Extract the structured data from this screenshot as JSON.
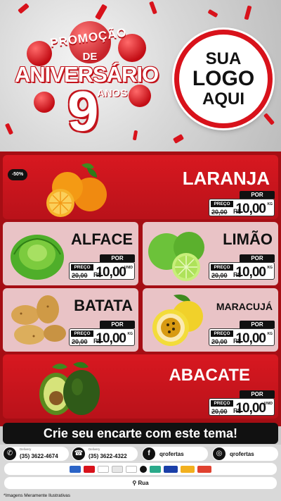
{
  "hero": {
    "promo_word": "PROMOÇÃO",
    "de": "DE",
    "aniversario": "ANIVERSÁRIO",
    "number": "9",
    "anos": "ANOS",
    "logo_line1": "SUA",
    "logo_line2": "LOGO",
    "logo_line3": "AQUI"
  },
  "offers": [
    {
      "name": "LARANJA",
      "discount": "-50%",
      "preco_label": "PREÇO",
      "por_label": "POR",
      "old_price": "20,00",
      "currency": "R$",
      "new_price": "10,00",
      "unit": "KG"
    },
    {
      "name": "ALFACE",
      "preco_label": "PREÇO",
      "por_label": "POR",
      "old_price": "20,00",
      "currency": "R$",
      "new_price": "10,00",
      "unit": "UNID"
    },
    {
      "name": "LIMÃO",
      "preco_label": "PREÇO",
      "por_label": "POR",
      "old_price": "20,00",
      "currency": "R$",
      "new_price": "10,00",
      "unit": "KG"
    },
    {
      "name": "BATATA",
      "preco_label": "PREÇO",
      "por_label": "POR",
      "old_price": "20,00",
      "currency": "R$",
      "new_price": "10,00",
      "unit": "KG"
    },
    {
      "name": "MARACUJÁ",
      "preco_label": "PREÇO",
      "por_label": "POR",
      "old_price": "20,00",
      "currency": "R$",
      "new_price": "10,00",
      "unit": "KG"
    },
    {
      "name": "ABACATE",
      "preco_label": "PREÇO",
      "por_label": "POR",
      "old_price": "20,00",
      "currency": "R$",
      "new_price": "10,00",
      "unit": "UNID"
    }
  ],
  "cta": "Crie seu encarte com este tema!",
  "contacts": {
    "whatsapp_label": "Delivery",
    "whatsapp": "(35) 3622-4674",
    "phone_label": "Delivery",
    "phone": "(35) 3622-4322",
    "facebook": "qrofertas",
    "instagram": "qrofertas",
    "address": "Rua"
  },
  "payments": [
    "#2b64c7",
    "#d8121b",
    "#ffffff",
    "#e6e6e6",
    "#ffffff",
    "#111111",
    "#2aa98a",
    "#1a3fa8",
    "#f2b01e",
    "#e0412f"
  ],
  "footnote": "*Imagens Meramente Ilustrativas",
  "colors": {
    "brand_red": "#d8121b",
    "dark_red": "#a50e14",
    "price_black": "#111111"
  }
}
